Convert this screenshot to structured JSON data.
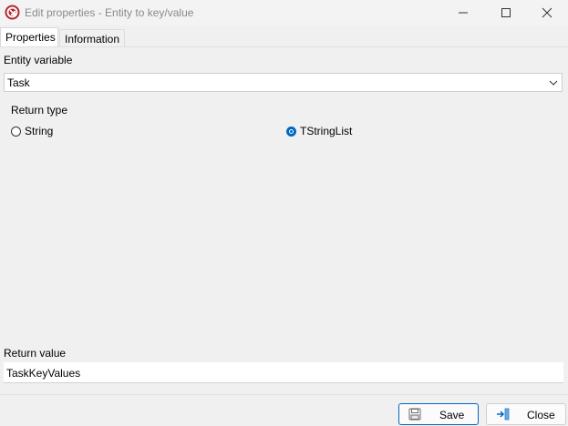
{
  "window": {
    "title": "Edit properties - Entity to key/value",
    "icon": "app-logo-icon"
  },
  "tabs": [
    {
      "label": "Properties",
      "active": true
    },
    {
      "label": "Information",
      "active": false
    }
  ],
  "form": {
    "entity_variable_label": "Entity variable",
    "entity_variable_value": "Task",
    "return_type_label": "Return type",
    "return_type_options": [
      {
        "label": "String",
        "selected": false
      },
      {
        "label": "TStringList",
        "selected": true
      }
    ],
    "return_value_label": "Return value",
    "return_value_value": "TaskKeyValues"
  },
  "buttons": {
    "save_label": "Save",
    "close_label": "Close"
  },
  "colors": {
    "accent": "#0067c0",
    "logo": "#b3262d"
  }
}
